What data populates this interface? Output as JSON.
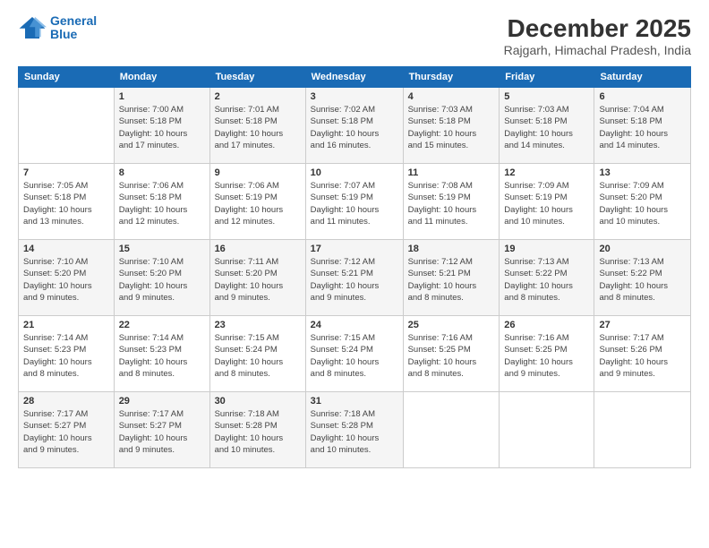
{
  "logo": {
    "line1": "General",
    "line2": "Blue"
  },
  "header": {
    "month": "December 2025",
    "location": "Rajgarh, Himachal Pradesh, India"
  },
  "weekdays": [
    "Sunday",
    "Monday",
    "Tuesday",
    "Wednesday",
    "Thursday",
    "Friday",
    "Saturday"
  ],
  "weeks": [
    [
      {
        "day": "",
        "info": ""
      },
      {
        "day": "1",
        "info": "Sunrise: 7:00 AM\nSunset: 5:18 PM\nDaylight: 10 hours\nand 17 minutes."
      },
      {
        "day": "2",
        "info": "Sunrise: 7:01 AM\nSunset: 5:18 PM\nDaylight: 10 hours\nand 17 minutes."
      },
      {
        "day": "3",
        "info": "Sunrise: 7:02 AM\nSunset: 5:18 PM\nDaylight: 10 hours\nand 16 minutes."
      },
      {
        "day": "4",
        "info": "Sunrise: 7:03 AM\nSunset: 5:18 PM\nDaylight: 10 hours\nand 15 minutes."
      },
      {
        "day": "5",
        "info": "Sunrise: 7:03 AM\nSunset: 5:18 PM\nDaylight: 10 hours\nand 14 minutes."
      },
      {
        "day": "6",
        "info": "Sunrise: 7:04 AM\nSunset: 5:18 PM\nDaylight: 10 hours\nand 14 minutes."
      }
    ],
    [
      {
        "day": "7",
        "info": "Sunrise: 7:05 AM\nSunset: 5:18 PM\nDaylight: 10 hours\nand 13 minutes."
      },
      {
        "day": "8",
        "info": "Sunrise: 7:06 AM\nSunset: 5:18 PM\nDaylight: 10 hours\nand 12 minutes."
      },
      {
        "day": "9",
        "info": "Sunrise: 7:06 AM\nSunset: 5:19 PM\nDaylight: 10 hours\nand 12 minutes."
      },
      {
        "day": "10",
        "info": "Sunrise: 7:07 AM\nSunset: 5:19 PM\nDaylight: 10 hours\nand 11 minutes."
      },
      {
        "day": "11",
        "info": "Sunrise: 7:08 AM\nSunset: 5:19 PM\nDaylight: 10 hours\nand 11 minutes."
      },
      {
        "day": "12",
        "info": "Sunrise: 7:09 AM\nSunset: 5:19 PM\nDaylight: 10 hours\nand 10 minutes."
      },
      {
        "day": "13",
        "info": "Sunrise: 7:09 AM\nSunset: 5:20 PM\nDaylight: 10 hours\nand 10 minutes."
      }
    ],
    [
      {
        "day": "14",
        "info": "Sunrise: 7:10 AM\nSunset: 5:20 PM\nDaylight: 10 hours\nand 9 minutes."
      },
      {
        "day": "15",
        "info": "Sunrise: 7:10 AM\nSunset: 5:20 PM\nDaylight: 10 hours\nand 9 minutes."
      },
      {
        "day": "16",
        "info": "Sunrise: 7:11 AM\nSunset: 5:20 PM\nDaylight: 10 hours\nand 9 minutes."
      },
      {
        "day": "17",
        "info": "Sunrise: 7:12 AM\nSunset: 5:21 PM\nDaylight: 10 hours\nand 9 minutes."
      },
      {
        "day": "18",
        "info": "Sunrise: 7:12 AM\nSunset: 5:21 PM\nDaylight: 10 hours\nand 8 minutes."
      },
      {
        "day": "19",
        "info": "Sunrise: 7:13 AM\nSunset: 5:22 PM\nDaylight: 10 hours\nand 8 minutes."
      },
      {
        "day": "20",
        "info": "Sunrise: 7:13 AM\nSunset: 5:22 PM\nDaylight: 10 hours\nand 8 minutes."
      }
    ],
    [
      {
        "day": "21",
        "info": "Sunrise: 7:14 AM\nSunset: 5:23 PM\nDaylight: 10 hours\nand 8 minutes."
      },
      {
        "day": "22",
        "info": "Sunrise: 7:14 AM\nSunset: 5:23 PM\nDaylight: 10 hours\nand 8 minutes."
      },
      {
        "day": "23",
        "info": "Sunrise: 7:15 AM\nSunset: 5:24 PM\nDaylight: 10 hours\nand 8 minutes."
      },
      {
        "day": "24",
        "info": "Sunrise: 7:15 AM\nSunset: 5:24 PM\nDaylight: 10 hours\nand 8 minutes."
      },
      {
        "day": "25",
        "info": "Sunrise: 7:16 AM\nSunset: 5:25 PM\nDaylight: 10 hours\nand 8 minutes."
      },
      {
        "day": "26",
        "info": "Sunrise: 7:16 AM\nSunset: 5:25 PM\nDaylight: 10 hours\nand 9 minutes."
      },
      {
        "day": "27",
        "info": "Sunrise: 7:17 AM\nSunset: 5:26 PM\nDaylight: 10 hours\nand 9 minutes."
      }
    ],
    [
      {
        "day": "28",
        "info": "Sunrise: 7:17 AM\nSunset: 5:27 PM\nDaylight: 10 hours\nand 9 minutes."
      },
      {
        "day": "29",
        "info": "Sunrise: 7:17 AM\nSunset: 5:27 PM\nDaylight: 10 hours\nand 9 minutes."
      },
      {
        "day": "30",
        "info": "Sunrise: 7:18 AM\nSunset: 5:28 PM\nDaylight: 10 hours\nand 10 minutes."
      },
      {
        "day": "31",
        "info": "Sunrise: 7:18 AM\nSunset: 5:28 PM\nDaylight: 10 hours\nand 10 minutes."
      },
      {
        "day": "",
        "info": ""
      },
      {
        "day": "",
        "info": ""
      },
      {
        "day": "",
        "info": ""
      }
    ]
  ]
}
